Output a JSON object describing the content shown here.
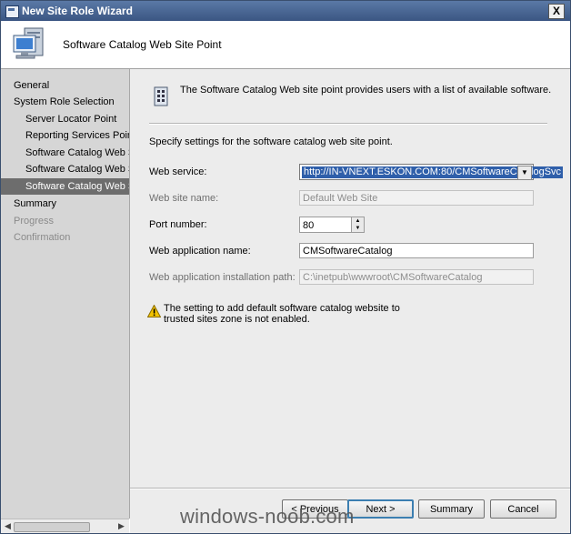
{
  "window": {
    "title": "New Site Role Wizard",
    "close_glyph": "X"
  },
  "header": {
    "title": "Software Catalog Web Site Point",
    "icon": "computer-icon"
  },
  "nav": {
    "items": [
      {
        "label": "General",
        "level": "top",
        "state": "normal"
      },
      {
        "label": "System Role Selection",
        "level": "top",
        "state": "normal"
      },
      {
        "label": "Server Locator Point",
        "level": "sub",
        "state": "normal"
      },
      {
        "label": "Reporting Services Point",
        "level": "sub",
        "state": "normal"
      },
      {
        "label": "Software Catalog Web Ser",
        "level": "sub",
        "state": "normal"
      },
      {
        "label": "Software Catalog Web Ser",
        "level": "sub",
        "state": "normal"
      },
      {
        "label": "Software Catalog Web Site",
        "level": "sub",
        "state": "selected"
      },
      {
        "label": "Summary",
        "level": "top",
        "state": "normal"
      },
      {
        "label": "Progress",
        "level": "top",
        "state": "disabled"
      },
      {
        "label": "Confirmation",
        "level": "top",
        "state": "disabled"
      }
    ]
  },
  "content": {
    "intro": "The Software Catalog Web site point provides users with a list of available software.",
    "instructions": "Specify settings for the software catalog web site point.",
    "web_service": {
      "label": "Web service:",
      "value": "http://IN-VNEXT.ESKON.COM:80/CMSoftwareCatalogSvc"
    },
    "web_site_name": {
      "label": "Web site name:",
      "value": "Default Web Site"
    },
    "port_number": {
      "label": "Port number:",
      "value": "80"
    },
    "web_app_name": {
      "label": "Web application name:",
      "value": "CMSoftwareCatalog"
    },
    "web_app_path": {
      "label": "Web application installation path:",
      "value": "C:\\inetpub\\wwwroot\\CMSoftwareCatalog"
    },
    "warning": "The setting to add default software catalog website to trusted sites zone is not enabled."
  },
  "buttons": {
    "previous": "< Previous",
    "next": "Next >",
    "summary": "Summary",
    "cancel": "Cancel"
  },
  "watermark": "windows-noob.com",
  "colors": {
    "titlebar": "#3b5683",
    "selected_nav": "#6d6d6d",
    "highlight": "#2f5faa",
    "warning": "#f2c200"
  }
}
